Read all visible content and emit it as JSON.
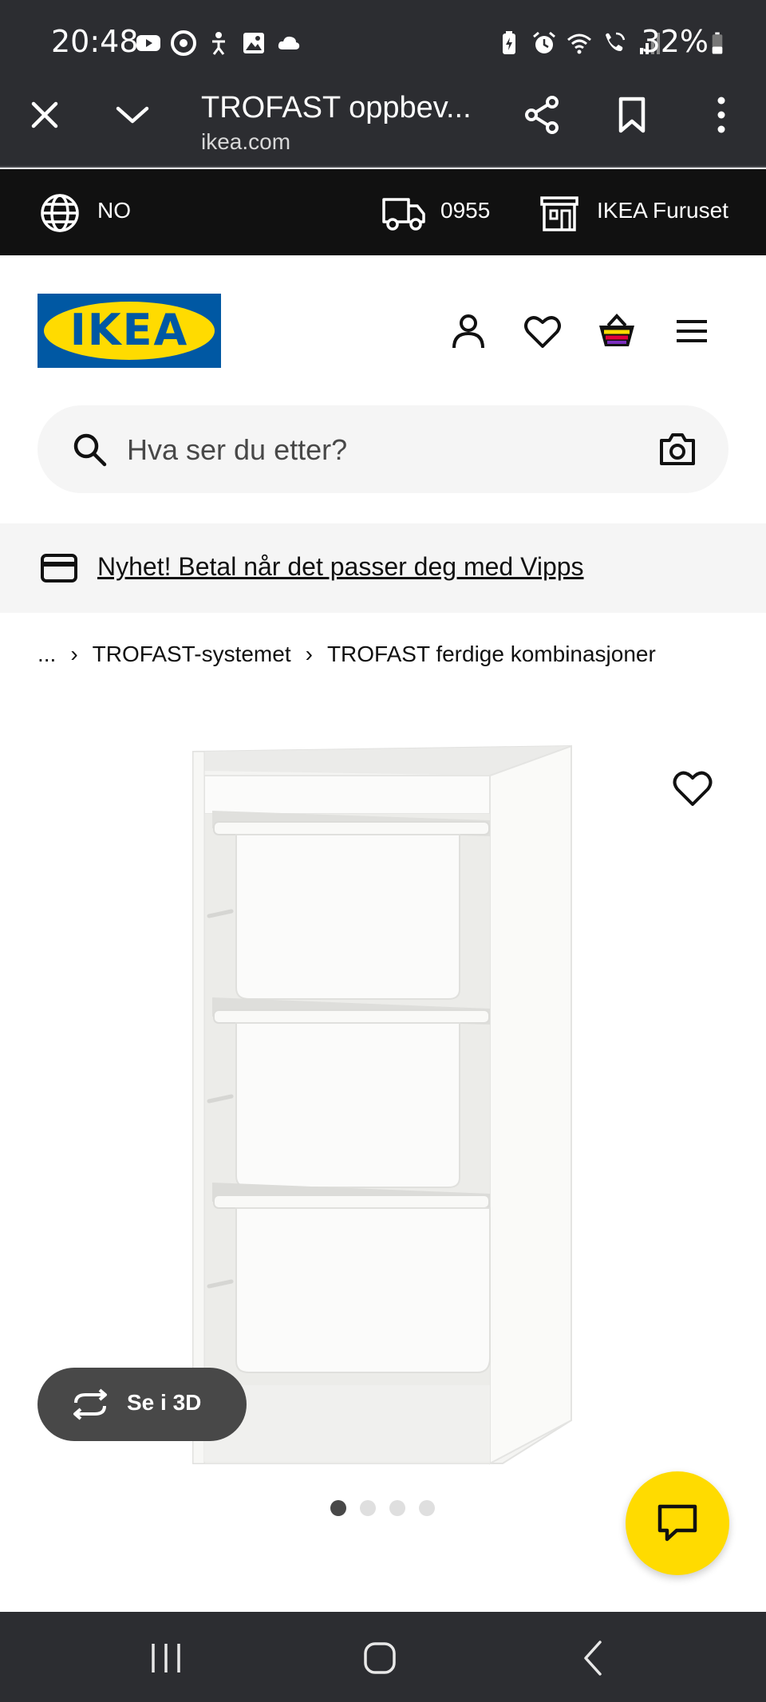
{
  "status_bar": {
    "time": "20:48",
    "battery": "32%",
    "left_icons": [
      "youtube-icon",
      "chrome-icon",
      "accessibility-icon",
      "gallery-icon",
      "cloud-icon"
    ],
    "right_icons": [
      "battery-saver-icon",
      "alarm-icon",
      "wifi-icon",
      "wifi-call-icon",
      "signal-icon",
      "battery-icon"
    ]
  },
  "browser": {
    "title": "TROFAST oppbev...",
    "url": "ikea.com"
  },
  "top_strip": {
    "language": "NO",
    "postal_code": "0955",
    "store": "IKEA Furuset"
  },
  "header": {
    "logo_text": "IKEA",
    "colors": {
      "logo_blue": "#0058a3",
      "logo_yellow": "#ffdb00"
    }
  },
  "search": {
    "placeholder": "Hva ser du etter?"
  },
  "promo": {
    "text": "Nyhet! Betal når det passer deg med Vipps"
  },
  "breadcrumb": {
    "ellipsis": "...",
    "items": [
      "TROFAST-systemet",
      "TROFAST ferdige kombinasjoner"
    ]
  },
  "product": {
    "view_3d_label": "Se i 3D",
    "carousel": {
      "total": 4,
      "active": 1
    }
  },
  "colors": {
    "dark_chrome": "#2c2d31",
    "strip": "#111111",
    "chat_fab": "#ffdb00"
  }
}
